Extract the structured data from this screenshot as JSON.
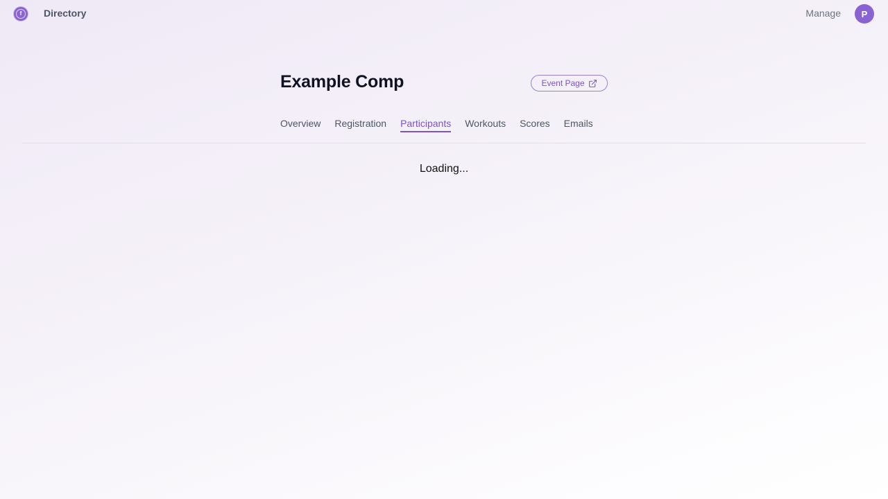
{
  "topbar": {
    "logo_letter": "f",
    "directory_label": "Directory",
    "manage_label": "Manage",
    "avatar_initial": "P"
  },
  "header": {
    "title": "Example Comp",
    "event_page_label": "Event Page"
  },
  "tabs": [
    {
      "label": "Overview",
      "active": false
    },
    {
      "label": "Registration",
      "active": false
    },
    {
      "label": "Participants",
      "active": true
    },
    {
      "label": "Workouts",
      "active": false
    },
    {
      "label": "Scores",
      "active": false
    },
    {
      "label": "Emails",
      "active": false
    }
  ],
  "status": {
    "loading_text": "Loading..."
  },
  "colors": {
    "accent": "#7c52c9",
    "avatar_bg": "#8a63d2"
  }
}
